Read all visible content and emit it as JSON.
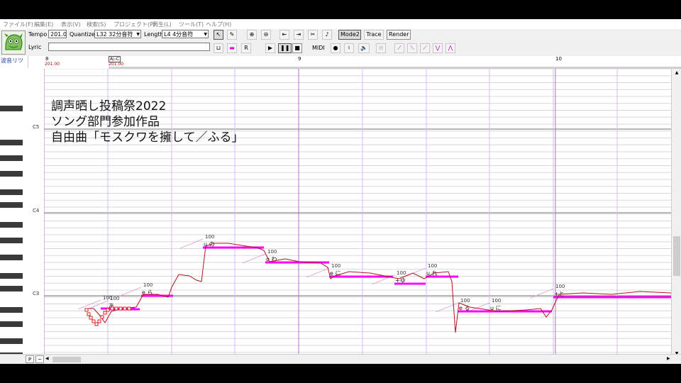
{
  "menu": [
    "ファイル(F)",
    "編集(E)",
    "表示(V)",
    "検索(S)",
    "プロジェクト(P)",
    "再生(L)",
    "ツール(T)",
    "ヘルプ(H)"
  ],
  "toolbar": {
    "tempo_label": "Tempo",
    "tempo_value": "201.0",
    "quantize_label": "Quantize",
    "quantize_value": "L32 32分音符",
    "length_label": "Length",
    "length_value": "L4  4分音符",
    "lyric_label": "Lyric",
    "lyric_value": "",
    "mode2": "Mode2",
    "trace": "Trace",
    "render": "Render",
    "midi": "MIDI"
  },
  "ruler": {
    "singer": "波音リツ",
    "tempo_marker": "A▷C",
    "tempo_values": [
      "201.00",
      "201.00"
    ],
    "measures": [
      "8",
      "9",
      "10"
    ]
  },
  "keyboard": {
    "labels": [
      "C5",
      "C4",
      "C3"
    ]
  },
  "overlay_text": [
    "調声晒し投稿祭2022",
    "ソング部門参加作品",
    "自由曲「モスクワを擁して／ふる」"
  ],
  "notes": [
    {
      "lyric": "",
      "velocity": "100"
    },
    {
      "lyric": "あ",
      "velocity": "100"
    },
    {
      "lyric": "e ら",
      "velocity": "100"
    },
    {
      "lyric": "u の",
      "velocity": "100"
    },
    {
      "lyric": "o わ",
      "velocity": "100"
    },
    {
      "lyric": "e に",
      "velocity": "100"
    },
    {
      "lyric": "+ゆ",
      "velocity": "100"
    },
    {
      "lyric": "u れ",
      "velocity": "100"
    },
    {
      "lyric": "e る",
      "velocity": "100"
    },
    {
      "lyric": "u に",
      "velocity": "100"
    },
    {
      "lyric": "+と",
      "velocity": "100"
    }
  ],
  "scroll": {
    "p_label": "P"
  },
  "colors": {
    "note": "#ff00ff",
    "pitch": "#b0121b",
    "measure_line": "#b86bd6",
    "beat_line": "#d7b9ef"
  }
}
